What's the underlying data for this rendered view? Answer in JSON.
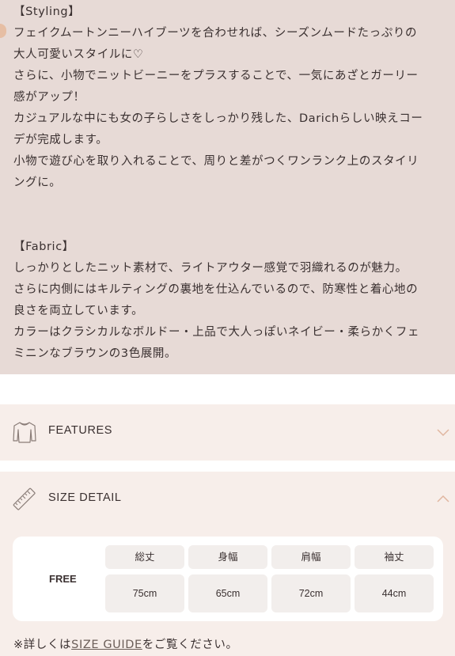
{
  "description": {
    "styling_heading": "【Styling】",
    "styling_lines": [
      "フェイクムートンニーハイブーツを合わせれば、シーズンムードたっぷりの",
      "大人可愛いスタイルに♡",
      "さらに、小物でニットビーニーをプラスすることで、一気にあざとガーリー",
      "感がアップ！",
      "カジュアルな中にも女の子らしさをしっかり残した、Darichらしい映えコー",
      "デが完成します。",
      "小物で遊び心を取り入れることで、周りと差がつくワンランク上のスタイリ",
      "ングに。"
    ],
    "fabric_heading": "【Fabric】",
    "fabric_lines": [
      "しっかりとしたニット素材で、ライトアウター感覚で羽織れるのが魅力。",
      "さらに内側にはキルティングの裏地を仕込んでいるので、防寒性と着心地の",
      "良さを両立しています。",
      "カラーはクラシカルなボルドー・上品で大人っぽいネイビー・柔らかくフェ",
      "ミニンなブラウンの3色展開。"
    ]
  },
  "features": {
    "title": "FEATURES",
    "icon": "sweater-icon",
    "state": "collapsed"
  },
  "size_detail": {
    "title": "SIZE DETAIL",
    "icon": "ruler-icon",
    "state": "expanded",
    "size_label": "FREE",
    "headers": [
      "総丈",
      "身幅",
      "肩幅",
      "袖丈"
    ],
    "values": [
      "75cm",
      "65cm",
      "72cm",
      "44cm"
    ]
  },
  "note": {
    "prefix": "※詳しくは",
    "link": "SIZE GUIDE",
    "suffix": "をご覧ください。"
  },
  "colors": {
    "desc_bg": "#e7dad6",
    "panel_bg": "#f7eeea",
    "accent": "#e6bea4",
    "text": "#3a3030"
  }
}
